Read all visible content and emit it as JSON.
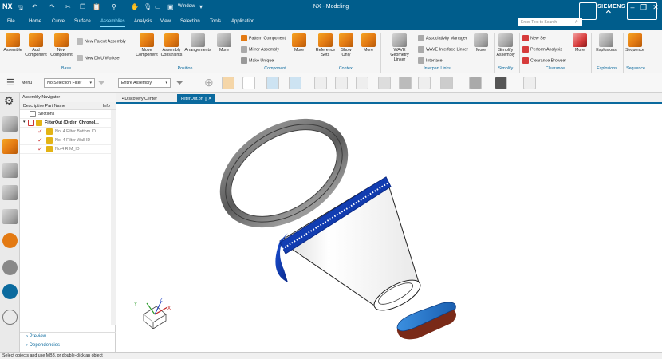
{
  "app": {
    "logo": "NX",
    "window_title": "NX - Modeling",
    "window_menu": "Window",
    "brand": "SIEMENS"
  },
  "menu": {
    "items": [
      "File",
      "Home",
      "Curve",
      "Surface",
      "Assemblies",
      "Analysis",
      "View",
      "Selection",
      "Tools",
      "Application"
    ],
    "active": "Assemblies",
    "search_placeholder": "Enter Text to Search"
  },
  "ribbon": {
    "base": {
      "label": "Base",
      "buttons": [
        "Assemble",
        "Add Component",
        "New Component"
      ],
      "small": [
        "New Parent Assembly",
        "New DMU Workset"
      ]
    },
    "position": {
      "label": "Position",
      "buttons": [
        "Move Component",
        "Assembly Constraints",
        "Arrangements",
        "More"
      ]
    },
    "component": {
      "label": "Component",
      "small": [
        "Pattern Component",
        "Mirror Assembly",
        "Make Unique"
      ],
      "more": "More"
    },
    "context": {
      "label": "Context",
      "buttons": [
        "Reference Sets",
        "Show Only",
        "More"
      ]
    },
    "interpart": {
      "label": "Interpart Links",
      "buttons": [
        "WAVE Geometry Linker"
      ],
      "small": [
        "Associativity Manager",
        "WAVE Interface Linker",
        "Interface"
      ],
      "more": "More"
    },
    "simplify": {
      "label": "Simplify",
      "buttons": [
        "Simplify Assembly"
      ]
    },
    "clearance": {
      "label": "Clearance",
      "small": [
        "New Set",
        "Perform Analysis",
        "Clearance Browser"
      ],
      "more": "More"
    },
    "explosions": {
      "label": "Explosions",
      "buttons": [
        "Explosions"
      ]
    },
    "sequence": {
      "label": "Sequence",
      "buttons": [
        "Sequence"
      ]
    }
  },
  "toolbar2": {
    "menu_label": "Menu",
    "filter": "No Selection Filter",
    "scope": "Entire Assembly"
  },
  "navigator": {
    "title": "Assembly Navigator",
    "col_name": "Descriptive Part Name",
    "col_info": "Info",
    "rows": [
      {
        "label": "Sections",
        "level": 0
      },
      {
        "label": "FilterOut (Order: Chronol...",
        "level": 0
      },
      {
        "label": "No. 4 Filter Bottom ID",
        "level": 1
      },
      {
        "label": "No. 4 Filter Wall ID",
        "level": 1
      },
      {
        "label": "No.4 RIM_ID",
        "level": 1
      }
    ],
    "panels": [
      "Preview",
      "Dependencies"
    ]
  },
  "tabs": [
    "Discovery Center",
    "FilterOut.prt"
  ],
  "status": "Select objects and use MB3, or double-click an object",
  "colors": {
    "accent": "#005d8c",
    "highlight": "#8fe0ff",
    "orange": "#e37a13",
    "blue_part": "#1a4fd6",
    "brown_part": "#7a2a18"
  },
  "viewport": {
    "triad_labels": [
      "Y",
      "Z",
      "X"
    ]
  }
}
